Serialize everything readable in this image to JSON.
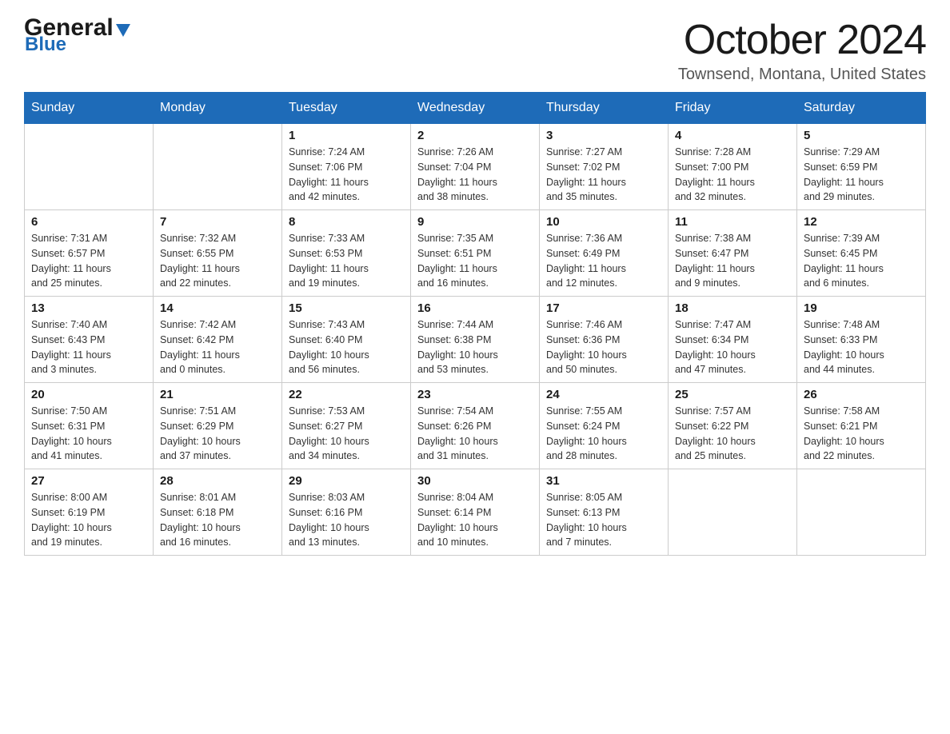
{
  "header": {
    "logo_general": "General",
    "logo_blue": "Blue",
    "month_title": "October 2024",
    "location": "Townsend, Montana, United States"
  },
  "days_of_week": [
    "Sunday",
    "Monday",
    "Tuesday",
    "Wednesday",
    "Thursday",
    "Friday",
    "Saturday"
  ],
  "weeks": [
    [
      {
        "day": "",
        "info": ""
      },
      {
        "day": "",
        "info": ""
      },
      {
        "day": "1",
        "info": "Sunrise: 7:24 AM\nSunset: 7:06 PM\nDaylight: 11 hours\nand 42 minutes."
      },
      {
        "day": "2",
        "info": "Sunrise: 7:26 AM\nSunset: 7:04 PM\nDaylight: 11 hours\nand 38 minutes."
      },
      {
        "day": "3",
        "info": "Sunrise: 7:27 AM\nSunset: 7:02 PM\nDaylight: 11 hours\nand 35 minutes."
      },
      {
        "day": "4",
        "info": "Sunrise: 7:28 AM\nSunset: 7:00 PM\nDaylight: 11 hours\nand 32 minutes."
      },
      {
        "day": "5",
        "info": "Sunrise: 7:29 AM\nSunset: 6:59 PM\nDaylight: 11 hours\nand 29 minutes."
      }
    ],
    [
      {
        "day": "6",
        "info": "Sunrise: 7:31 AM\nSunset: 6:57 PM\nDaylight: 11 hours\nand 25 minutes."
      },
      {
        "day": "7",
        "info": "Sunrise: 7:32 AM\nSunset: 6:55 PM\nDaylight: 11 hours\nand 22 minutes."
      },
      {
        "day": "8",
        "info": "Sunrise: 7:33 AM\nSunset: 6:53 PM\nDaylight: 11 hours\nand 19 minutes."
      },
      {
        "day": "9",
        "info": "Sunrise: 7:35 AM\nSunset: 6:51 PM\nDaylight: 11 hours\nand 16 minutes."
      },
      {
        "day": "10",
        "info": "Sunrise: 7:36 AM\nSunset: 6:49 PM\nDaylight: 11 hours\nand 12 minutes."
      },
      {
        "day": "11",
        "info": "Sunrise: 7:38 AM\nSunset: 6:47 PM\nDaylight: 11 hours\nand 9 minutes."
      },
      {
        "day": "12",
        "info": "Sunrise: 7:39 AM\nSunset: 6:45 PM\nDaylight: 11 hours\nand 6 minutes."
      }
    ],
    [
      {
        "day": "13",
        "info": "Sunrise: 7:40 AM\nSunset: 6:43 PM\nDaylight: 11 hours\nand 3 minutes."
      },
      {
        "day": "14",
        "info": "Sunrise: 7:42 AM\nSunset: 6:42 PM\nDaylight: 11 hours\nand 0 minutes."
      },
      {
        "day": "15",
        "info": "Sunrise: 7:43 AM\nSunset: 6:40 PM\nDaylight: 10 hours\nand 56 minutes."
      },
      {
        "day": "16",
        "info": "Sunrise: 7:44 AM\nSunset: 6:38 PM\nDaylight: 10 hours\nand 53 minutes."
      },
      {
        "day": "17",
        "info": "Sunrise: 7:46 AM\nSunset: 6:36 PM\nDaylight: 10 hours\nand 50 minutes."
      },
      {
        "day": "18",
        "info": "Sunrise: 7:47 AM\nSunset: 6:34 PM\nDaylight: 10 hours\nand 47 minutes."
      },
      {
        "day": "19",
        "info": "Sunrise: 7:48 AM\nSunset: 6:33 PM\nDaylight: 10 hours\nand 44 minutes."
      }
    ],
    [
      {
        "day": "20",
        "info": "Sunrise: 7:50 AM\nSunset: 6:31 PM\nDaylight: 10 hours\nand 41 minutes."
      },
      {
        "day": "21",
        "info": "Sunrise: 7:51 AM\nSunset: 6:29 PM\nDaylight: 10 hours\nand 37 minutes."
      },
      {
        "day": "22",
        "info": "Sunrise: 7:53 AM\nSunset: 6:27 PM\nDaylight: 10 hours\nand 34 minutes."
      },
      {
        "day": "23",
        "info": "Sunrise: 7:54 AM\nSunset: 6:26 PM\nDaylight: 10 hours\nand 31 minutes."
      },
      {
        "day": "24",
        "info": "Sunrise: 7:55 AM\nSunset: 6:24 PM\nDaylight: 10 hours\nand 28 minutes."
      },
      {
        "day": "25",
        "info": "Sunrise: 7:57 AM\nSunset: 6:22 PM\nDaylight: 10 hours\nand 25 minutes."
      },
      {
        "day": "26",
        "info": "Sunrise: 7:58 AM\nSunset: 6:21 PM\nDaylight: 10 hours\nand 22 minutes."
      }
    ],
    [
      {
        "day": "27",
        "info": "Sunrise: 8:00 AM\nSunset: 6:19 PM\nDaylight: 10 hours\nand 19 minutes."
      },
      {
        "day": "28",
        "info": "Sunrise: 8:01 AM\nSunset: 6:18 PM\nDaylight: 10 hours\nand 16 minutes."
      },
      {
        "day": "29",
        "info": "Sunrise: 8:03 AM\nSunset: 6:16 PM\nDaylight: 10 hours\nand 13 minutes."
      },
      {
        "day": "30",
        "info": "Sunrise: 8:04 AM\nSunset: 6:14 PM\nDaylight: 10 hours\nand 10 minutes."
      },
      {
        "day": "31",
        "info": "Sunrise: 8:05 AM\nSunset: 6:13 PM\nDaylight: 10 hours\nand 7 minutes."
      },
      {
        "day": "",
        "info": ""
      },
      {
        "day": "",
        "info": ""
      }
    ]
  ]
}
